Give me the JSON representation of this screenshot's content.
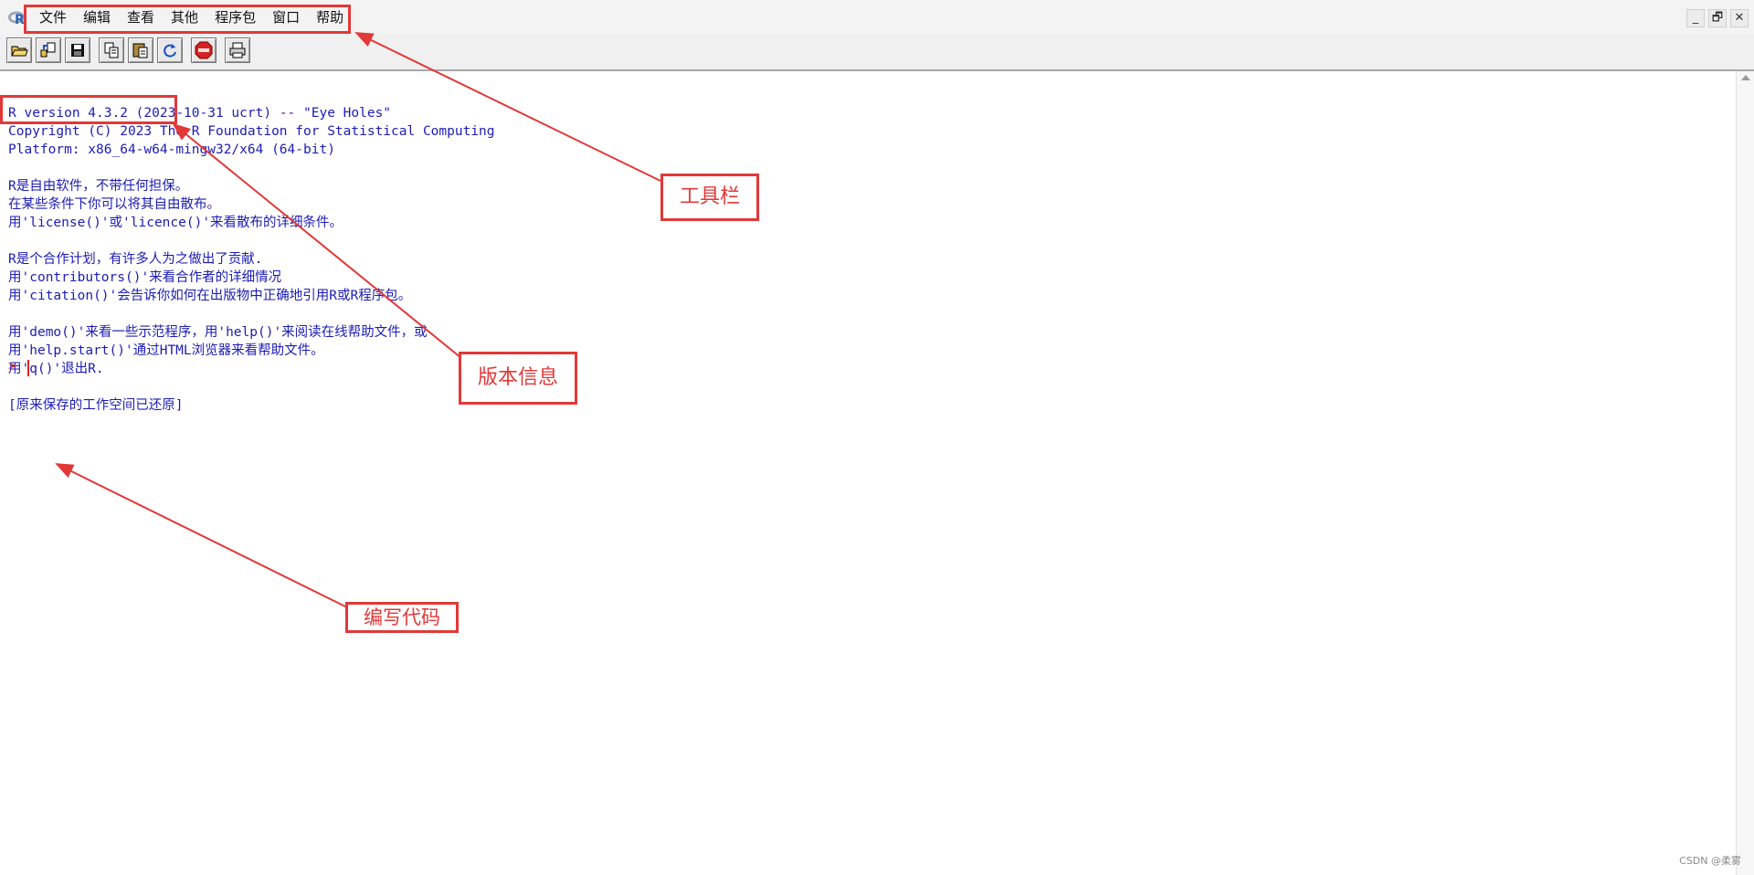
{
  "menubar": {
    "items": [
      "文件",
      "编辑",
      "查看",
      "其他",
      "程序包",
      "窗口",
      "帮助"
    ]
  },
  "window_controls": {
    "minimize": "_",
    "restore": "🗗",
    "close": "✕"
  },
  "toolbar": {
    "buttons": [
      "open-script-icon",
      "load-workspace-icon",
      "save-icon",
      "copy-icon",
      "paste-icon",
      "refresh-icon",
      "stop-icon",
      "print-icon"
    ]
  },
  "console": {
    "lines": [
      "R version 4.3.2 (2023-10-31 ucrt) -- \"Eye Holes\"",
      "Copyright (C) 2023 The R Foundation for Statistical Computing",
      "Platform: x86_64-w64-mingw32/x64 (64-bit)",
      "",
      "R是自由软件，不带任何担保。",
      "在某些条件下你可以将其自由散布。",
      "用'license()'或'licence()'来看散布的详细条件。",
      "",
      "R是个合作计划，有许多人为之做出了贡献.",
      "用'contributors()'来看合作者的详细情况",
      "用'citation()'会告诉你如何在出版物中正确地引用R或R程序包。",
      "",
      "用'demo()'来看一些示范程序，用'help()'来阅读在线帮助文件，或",
      "用'help.start()'通过HTML浏览器来看帮助文件。",
      "用'q()'退出R.",
      "",
      "[原来保存的工作空间已还原]"
    ],
    "prompt": ">"
  },
  "annotations": {
    "toolbar_label": "工具栏",
    "version_label": "版本信息",
    "code_label": "编写代码",
    "color": "#e23838"
  },
  "watermark": "CSDN @柔雾"
}
